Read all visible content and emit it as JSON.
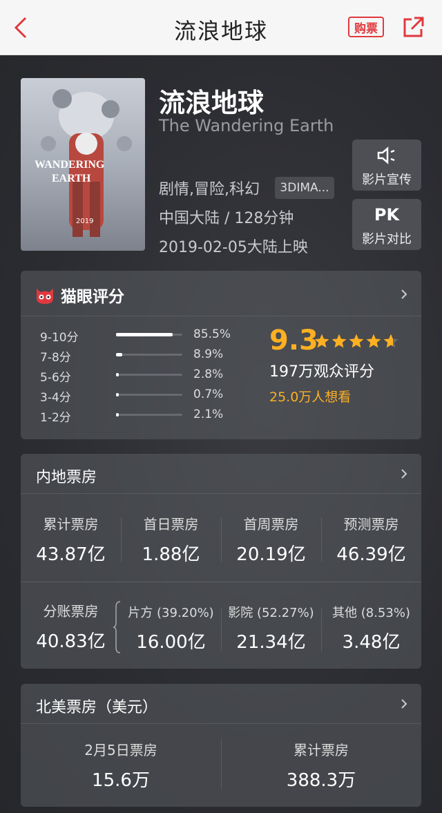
{
  "nav": {
    "title": "流浪地球",
    "buy_label": "购票"
  },
  "movie": {
    "title": "流浪地球",
    "english_title": "The Wandering Earth",
    "genres": "剧情,冒险,科幻",
    "format": "3DIMA...",
    "region_duration": "中国大陆 / 128分钟",
    "release": "2019-02-05大陆上映"
  },
  "side_buttons": [
    {
      "label": "影片宣传",
      "icon": "speaker-icon"
    },
    {
      "label": "影片对比",
      "icon_text": "PK"
    }
  ],
  "rating": {
    "title": "猫眼评分",
    "score": "9.3",
    "stars": 4.65,
    "raters": "197万观众评分",
    "wants": "25.0万人想看",
    "distribution": [
      {
        "label": "9-10分",
        "pct": "85.5%",
        "value": 85.5
      },
      {
        "label": "7-8分",
        "pct": "8.9%",
        "value": 8.9
      },
      {
        "label": "5-6分",
        "pct": "2.8%",
        "value": 2.8
      },
      {
        "label": "3-4分",
        "pct": "0.7%",
        "value": 0.7
      },
      {
        "label": "1-2分",
        "pct": "2.1%",
        "value": 2.1
      }
    ]
  },
  "mainland_box": {
    "title": "内地票房",
    "top_stats": [
      {
        "label": "累计票房",
        "value": "43.87亿"
      },
      {
        "label": "首日票房",
        "value": "1.88亿"
      },
      {
        "label": "首周票房",
        "value": "20.19亿"
      },
      {
        "label": "预测票房",
        "value": "46.39亿"
      }
    ],
    "split": {
      "label": "分账票房",
      "value": "40.83亿"
    },
    "split_parts": [
      {
        "label": "片方 (39.20%)",
        "value": "16.00亿"
      },
      {
        "label": "影院 (52.27%)",
        "value": "21.34亿"
      },
      {
        "label": "其他 (8.53%)",
        "value": "3.48亿"
      }
    ]
  },
  "na_box": {
    "title": "北美票房（美元）",
    "stats": [
      {
        "label": "2月5日票房",
        "value": "15.6万"
      },
      {
        "label": "累计票房",
        "value": "388.3万"
      }
    ]
  },
  "colors": {
    "accent": "#e0393e",
    "gold": "#fdb022"
  }
}
